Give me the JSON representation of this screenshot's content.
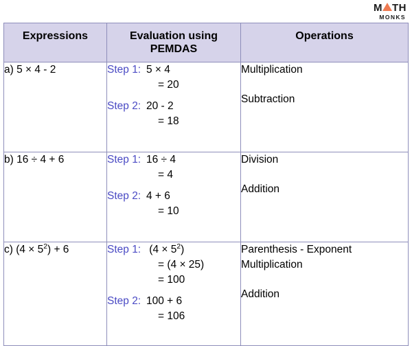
{
  "logo": {
    "name": "math-monks-logo",
    "main_before": "M",
    "main_after": "TH",
    "sub": "MONKS",
    "triangle_color": "#ef7b52"
  },
  "theme": {
    "header_bg": "#d6d3ea",
    "border": "#8d8dba",
    "step_label_color": "#4a4ac4",
    "text_color": "#000000"
  },
  "table": {
    "headers": {
      "expressions": "Expressions",
      "evaluation_line1": "Evaluation using",
      "evaluation_line2": "PEMDAS",
      "operations": "Operations"
    },
    "rows": [
      {
        "expression": "a) 5 × 4 - 2",
        "steps": [
          {
            "label": "Step 1:",
            "lines": [
              "5 × 4",
              "= 20"
            ]
          },
          {
            "label": "Step 2:",
            "lines": [
              "20 - 2",
              "= 18"
            ]
          }
        ],
        "operations": [
          {
            "text": "Multiplication"
          },
          {
            "text": "Subtraction"
          }
        ]
      },
      {
        "expression": "b) 16 ÷ 4 + 6",
        "steps": [
          {
            "label": "Step 1:",
            "lines": [
              "16 ÷ 4",
              "= 4"
            ]
          },
          {
            "label": "Step 2:",
            "lines": [
              "4 + 6",
              "= 10"
            ]
          }
        ],
        "operations": [
          {
            "text": "Division"
          },
          {
            "text": "Addition"
          }
        ]
      },
      {
        "expression": "c) (4 × 5²) + 6",
        "steps": [
          {
            "label": "Step 1:",
            "lines": [
              "(4 × 5²)",
              "= (4 × 25)",
              "= 100"
            ]
          },
          {
            "label": "Step 2:",
            "lines": [
              "100 + 6",
              "= 106"
            ]
          }
        ],
        "operations": [
          {
            "text": "Parenthesis - Exponent"
          },
          {
            "text": "Multiplication"
          },
          {
            "text": "Addition"
          }
        ]
      }
    ]
  }
}
